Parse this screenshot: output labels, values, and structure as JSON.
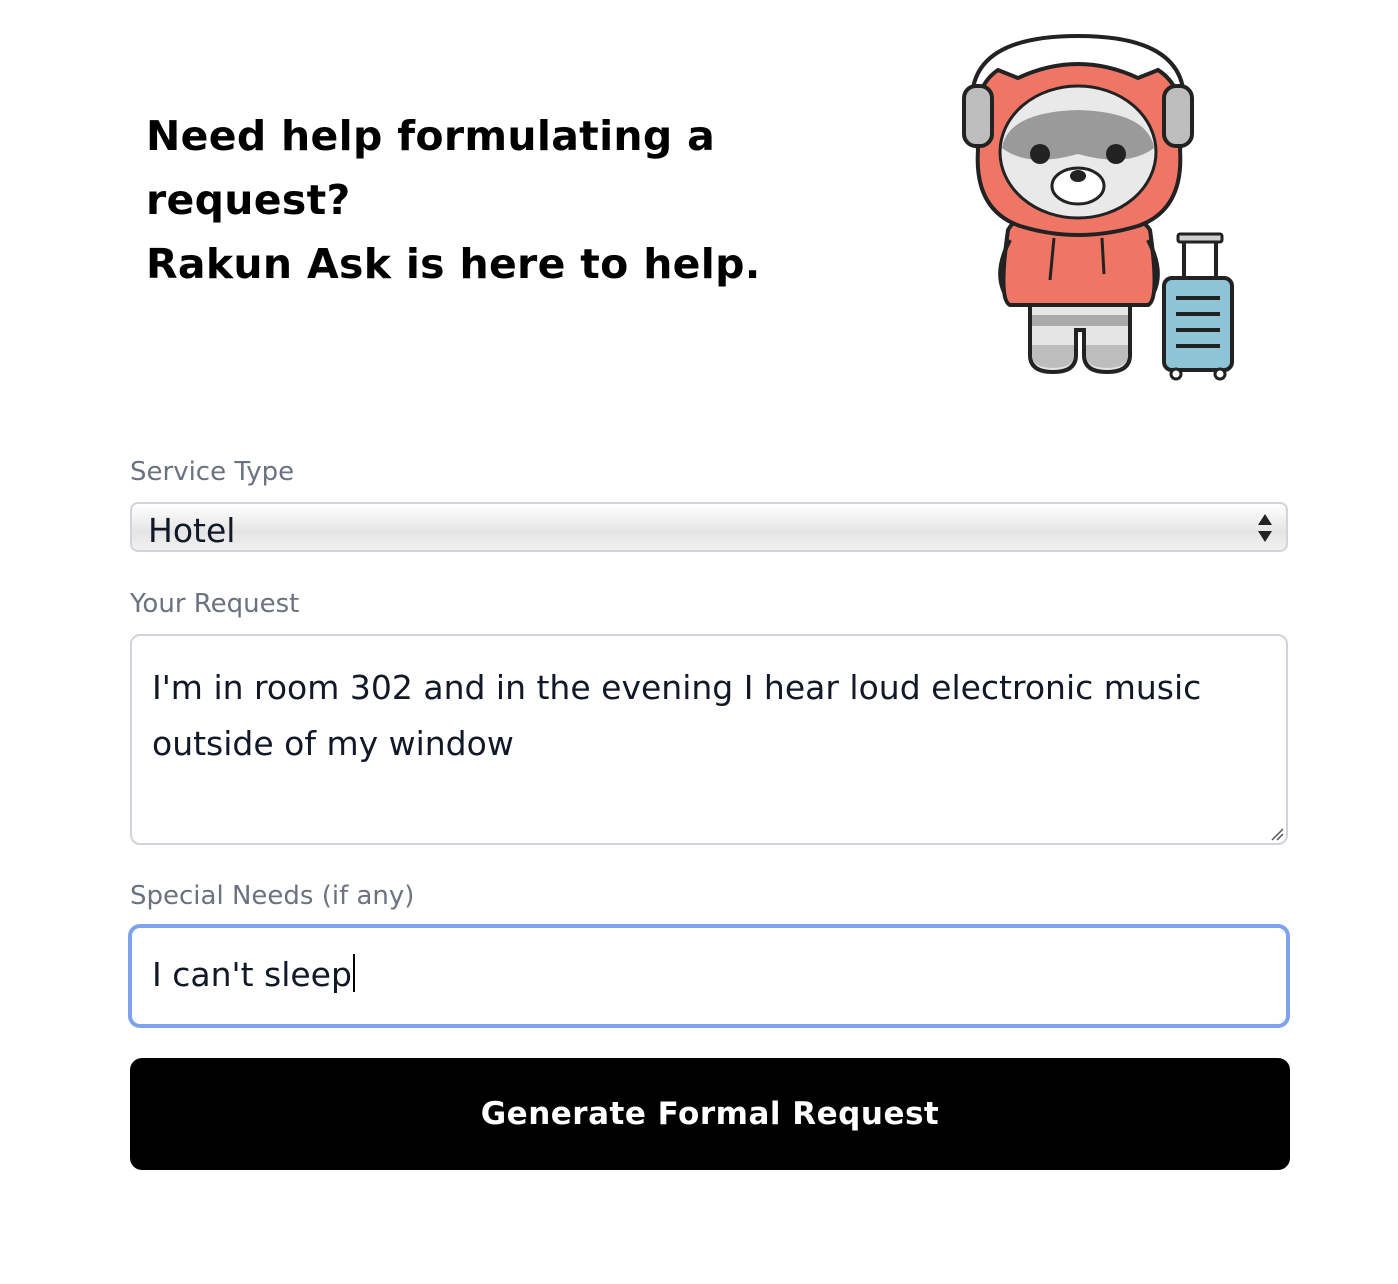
{
  "hero": {
    "heading_lines": [
      "Need help formulating a",
      "request?",
      "Rakun Ask is here to help."
    ]
  },
  "mascot": {
    "icon": "raccoon-traveler-illustration"
  },
  "form": {
    "service_type": {
      "label": "Service Type",
      "value": "Hotel"
    },
    "request": {
      "label": "Your Request",
      "value": "I'm in room 302 and in the evening I hear loud electronic music outside of my window"
    },
    "special_needs": {
      "label": "Special Needs (if any)",
      "value": "I can't sleep"
    },
    "submit_label": "Generate Formal Request"
  },
  "colors": {
    "hoodie": "#ef7565",
    "luggage": "#8ec5d6",
    "focus_ring": "#7ea3ee",
    "button_bg": "#000000"
  }
}
